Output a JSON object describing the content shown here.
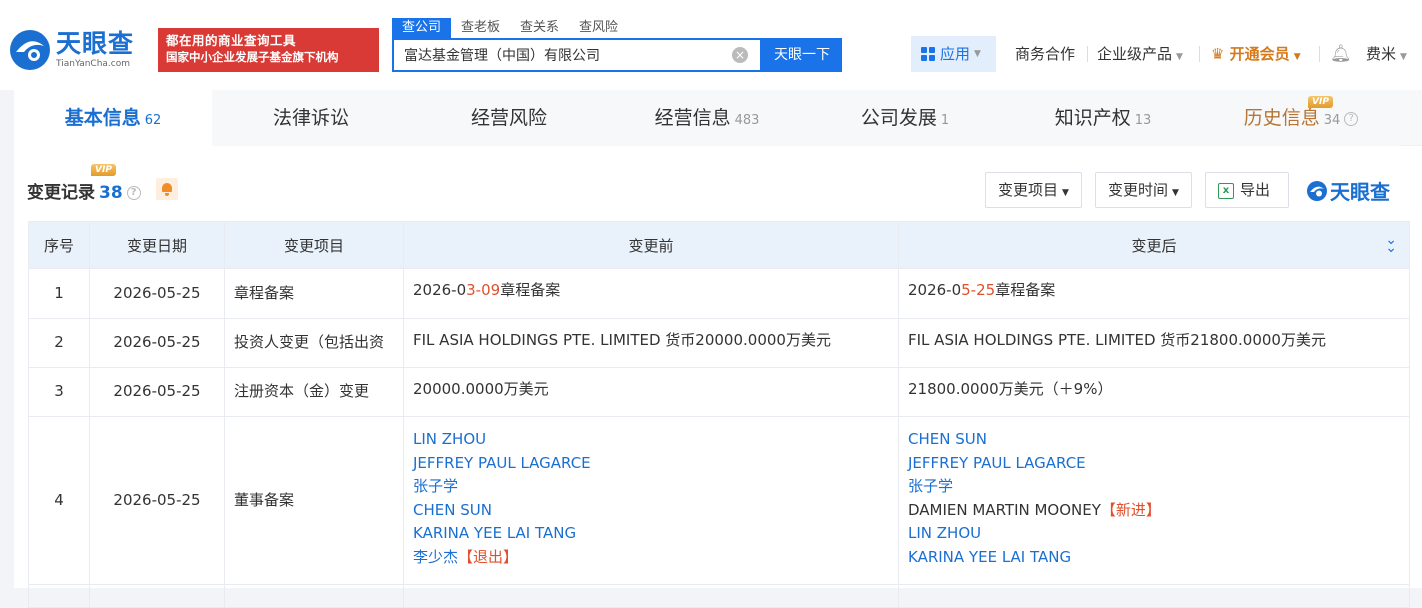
{
  "header": {
    "logo_cn": "天眼查",
    "logo_en": "TianYanCha.com",
    "slogan_line1": "都在用的商业查询工具",
    "slogan_line2": "国家中小企业发展子基金旗下机构",
    "search_tabs": [
      "查公司",
      "查老板",
      "查关系",
      "查风险"
    ],
    "search_value": "富达基金管理（中国）有限公司",
    "search_button": "天眼一下",
    "app_label": "应用",
    "nav_business": "商务合作",
    "nav_enterprise": "企业级产品",
    "nav_vip": "开通会员",
    "user_name": "费米"
  },
  "tabs": [
    {
      "label": "基本信息",
      "count": "62"
    },
    {
      "label": "法律诉讼",
      "count": ""
    },
    {
      "label": "经营风险",
      "count": ""
    },
    {
      "label": "经营信息",
      "count": "483"
    },
    {
      "label": "公司发展",
      "count": "1"
    },
    {
      "label": "知识产权",
      "count": "13"
    },
    {
      "label": "历史信息",
      "count": "34"
    }
  ],
  "vip_badge": "VIP",
  "section": {
    "title": "变更记录",
    "count": "38",
    "filter_item": "变更项目",
    "filter_time": "变更时间",
    "export": "导出",
    "brand": "天眼查"
  },
  "table": {
    "headers": [
      "序号",
      "变更日期",
      "变更项目",
      "变更前",
      "变更后"
    ],
    "rows": [
      {
        "no": "1",
        "date": "2026-05-25",
        "item": "章程备案",
        "before": [
          {
            "t": "2026-0"
          },
          {
            "t": "3-09",
            "hl": true
          },
          {
            "t": "章程备案"
          }
        ],
        "after": [
          {
            "t": "2026-0"
          },
          {
            "t": "5-25",
            "hl": true
          },
          {
            "t": "章程备案"
          }
        ]
      },
      {
        "no": "2",
        "date": "2026-05-25",
        "item": "投资人变更（包括出资",
        "before_text": "FIL ASIA HOLDINGS PTE. LIMITED 货币20000.0000万美元",
        "after_text": "FIL ASIA HOLDINGS PTE. LIMITED 货币21800.0000万美元"
      },
      {
        "no": "3",
        "date": "2026-05-25",
        "item": "注册资本（金）变更",
        "before_text": "20000.0000万美元",
        "after_text": "21800.0000万美元（＋9%）"
      },
      {
        "no": "4",
        "date": "2026-05-25",
        "item": "董事备案",
        "before_people": [
          {
            "name": "LIN ZHOU",
            "link": true,
            "tag": ""
          },
          {
            "name": "JEFFREY PAUL LAGARCE",
            "link": true,
            "tag": ""
          },
          {
            "name": "张子学",
            "link": true,
            "tag": ""
          },
          {
            "name": "CHEN SUN",
            "link": true,
            "tag": ""
          },
          {
            "name": "KARINA YEE LAI TANG",
            "link": true,
            "tag": ""
          },
          {
            "name": "李少杰",
            "link": true,
            "tag": "【退出】"
          }
        ],
        "after_people": [
          {
            "name": "CHEN SUN",
            "link": true,
            "tag": ""
          },
          {
            "name": "JEFFREY PAUL LAGARCE",
            "link": true,
            "tag": ""
          },
          {
            "name": "张子学",
            "link": true,
            "tag": ""
          },
          {
            "name": "DAMIEN MARTIN MOONEY",
            "link": false,
            "tag": "【新进】"
          },
          {
            "name": "LIN ZHOU",
            "link": true,
            "tag": ""
          },
          {
            "name": "KARINA YEE LAI TANG",
            "link": true,
            "tag": ""
          }
        ]
      }
    ]
  },
  "colors": {
    "brand_blue": "#1a73e8",
    "highlight_red": "#e0502d",
    "vip_orange": "#d57a1c"
  }
}
